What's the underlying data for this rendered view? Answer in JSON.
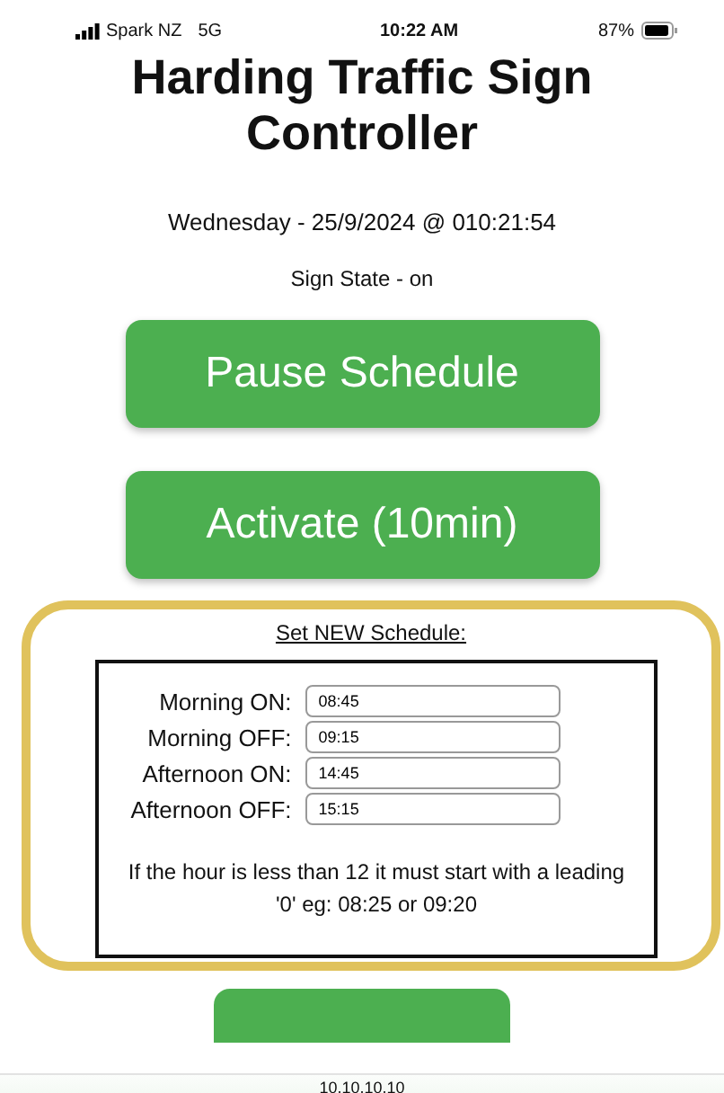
{
  "status_bar": {
    "carrier": "Spark NZ",
    "network": "5G",
    "time": "10:22 AM",
    "battery": "87%"
  },
  "title": "Harding Traffic Sign Controller",
  "datetime": "Wednesday - 25/9/2024 @ 010:21:54",
  "sign_state": "Sign State - on",
  "buttons": [
    "Pause Schedule",
    "Activate (10min)"
  ],
  "schedule": {
    "heading": "Set NEW Schedule:",
    "fields": [
      {
        "label": "Morning ON:",
        "value": "08:45"
      },
      {
        "label": "Morning OFF:",
        "value": "09:15"
      },
      {
        "label": "Afternoon ON:",
        "value": "14:45"
      },
      {
        "label": "Afternoon OFF:",
        "value": "15:15"
      }
    ],
    "note": "If the hour is less than 12 it must start with a leading '0' eg: 08:25 or 09:20"
  },
  "address_bar": {
    "url": "10.10.10.10"
  }
}
